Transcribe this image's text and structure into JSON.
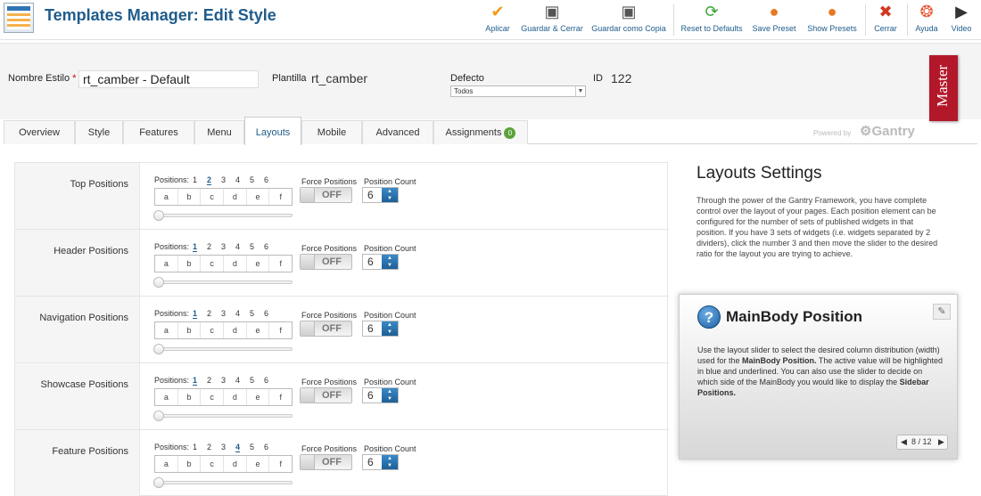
{
  "toolbar": {
    "title": "Templates Manager: Edit Style",
    "buttons": [
      {
        "label": "Aplicar",
        "icon": "checkmark-icon",
        "color": "#f29b1d"
      },
      {
        "label": "Guardar & Cerrar",
        "icon": "save-icon",
        "color": "#555555"
      },
      {
        "label": "Guardar como Copia",
        "icon": "save-copy-icon",
        "color": "#555555"
      },
      {
        "label": "Reset to Defaults",
        "icon": "refresh-icon",
        "color": "#3aa335"
      },
      {
        "label": "Save Preset",
        "icon": "save-preset-icon",
        "color": "#e87722"
      },
      {
        "label": "Show Presets",
        "icon": "show-presets-icon",
        "color": "#e87722"
      },
      {
        "label": "Cerrar",
        "icon": "close-icon",
        "color": "#d0381f"
      },
      {
        "label": "Ayuda",
        "icon": "help-icon",
        "color": "#e8542e"
      },
      {
        "label": "Video",
        "icon": "video-icon",
        "color": "#333333"
      }
    ]
  },
  "form": {
    "nombre_label": "Nombre Estilo",
    "required_mark": "*",
    "nombre_value": "rt_camber - Default",
    "plantilla_label": "Plantilla",
    "plantilla_value": "rt_camber",
    "defecto_label": "Defecto",
    "defecto_value": "Todos",
    "id_label": "ID",
    "id_value": "122"
  },
  "ribbon": {
    "label": "Master",
    "color": "#b3182a"
  },
  "tabs": [
    {
      "label": "Overview"
    },
    {
      "label": "Style"
    },
    {
      "label": "Features"
    },
    {
      "label": "Menu"
    },
    {
      "label": "Layouts",
      "active": true
    },
    {
      "label": "Mobile"
    },
    {
      "label": "Advanced"
    },
    {
      "label": "Assignments",
      "badge": "0"
    }
  ],
  "powered": {
    "text": "Powered by",
    "brand": "Gantry"
  },
  "layout_rows": {
    "positions_label": "Positions:",
    "letters": [
      "a",
      "b",
      "c",
      "d",
      "e",
      "f"
    ],
    "numbers": [
      "1",
      "2",
      "3",
      "4",
      "5",
      "6"
    ],
    "force_label": "Force Positions",
    "count_label": "Position Count",
    "items": [
      {
        "label": "Top Positions",
        "active": "2",
        "force": "OFF",
        "count": "6"
      },
      {
        "label": "Header Positions",
        "active": "1",
        "force": "OFF",
        "count": "6"
      },
      {
        "label": "Navigation Positions",
        "active": "1",
        "force": "OFF",
        "count": "6"
      },
      {
        "label": "Showcase Positions",
        "active": "1",
        "force": "OFF",
        "count": "6"
      },
      {
        "label": "Feature Positions",
        "active": "4",
        "force": "OFF",
        "count": "6"
      }
    ]
  },
  "settings": {
    "title": "Layouts Settings",
    "text": "Through the power of the Gantry Framework, you have complete control over the layout of your pages. Each position element can be configured for the number of sets of published widgets in that position. If you have 3 sets of widgets (i.e. widgets separated by 2 dividers), click the number 3 and then move the slider to the desired ratio for the layout you are trying to achieve."
  },
  "infobox": {
    "title": "MainBody Position",
    "t1": "Use the layout slider to select the desired column distribution (width) used for the ",
    "b1": "MainBody Position.",
    "t2": " The active value will be highlighted in blue and underlined. You can also use the slider to decide on which side of the MainBody you would like to display the ",
    "b2": "Sidebar Positions.",
    "pager": "8 / 12",
    "accent": "#1f5c8c"
  }
}
